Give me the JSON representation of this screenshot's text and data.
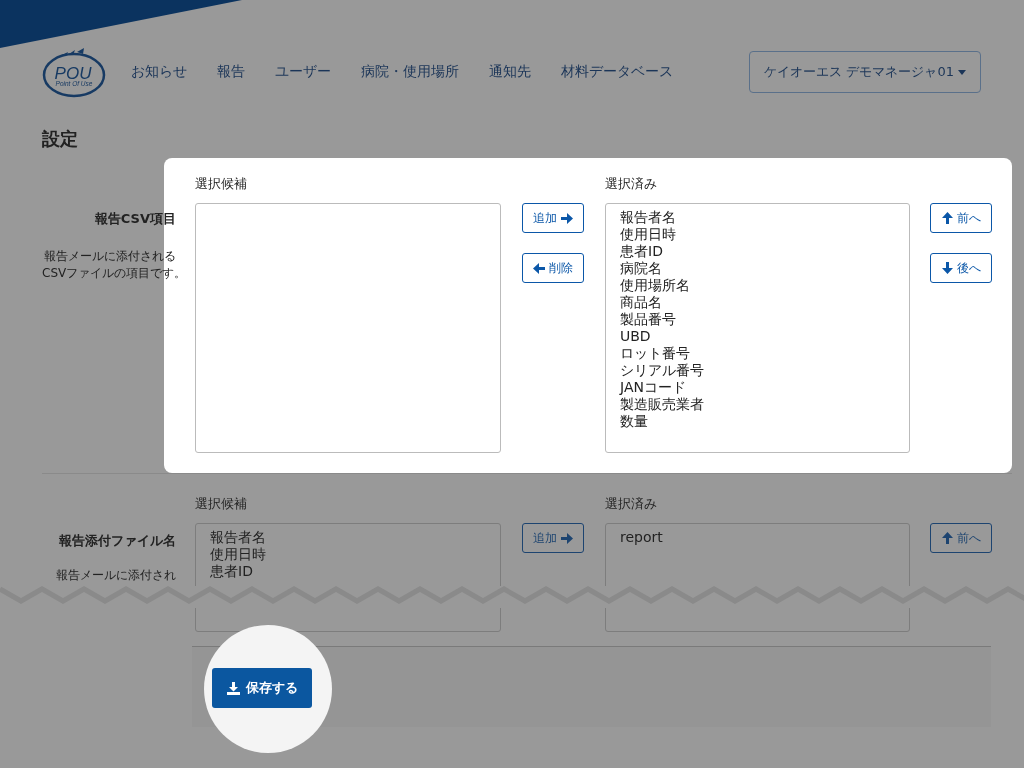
{
  "logo": {
    "text": "POU",
    "tagline": "Point Of Use"
  },
  "nav": [
    {
      "label": "お知らせ"
    },
    {
      "label": "報告"
    },
    {
      "label": "ユーザー"
    },
    {
      "label": "病院・使用場所"
    },
    {
      "label": "通知先"
    },
    {
      "label": "材料データベース"
    }
  ],
  "user_menu": "ケイオーエス デモマネージャ01",
  "page_title": "設定",
  "sections": [
    {
      "label": "報告CSV項目",
      "description": [
        "報告メールに添付される",
        "CSVファイルの項目です。"
      ],
      "highlighted": true,
      "available_title": "選択候補",
      "add": "追加",
      "remove": "削除",
      "selected_title": "選択済み",
      "selected": [
        "報告者名",
        "使用日時",
        "患者ID",
        "病院名",
        "使用場所名",
        "商品名",
        "製品番号",
        "UBD",
        "ロット番号",
        "シリアル番号",
        "JANコード",
        "製造販売業者",
        "数量"
      ],
      "up": "前へ",
      "down": "後へ"
    },
    {
      "label": "報告添付ファイル名",
      "description": [
        "報告メールに添付され"
      ],
      "highlighted": false,
      "available_title": "選択候補",
      "available": [
        "報告者名",
        "使用日時",
        "患者ID"
      ],
      "add": "追加",
      "selected_title": "選択済み",
      "selected": [
        "report"
      ],
      "up": "前へ"
    }
  ],
  "save_button": "保存する"
}
